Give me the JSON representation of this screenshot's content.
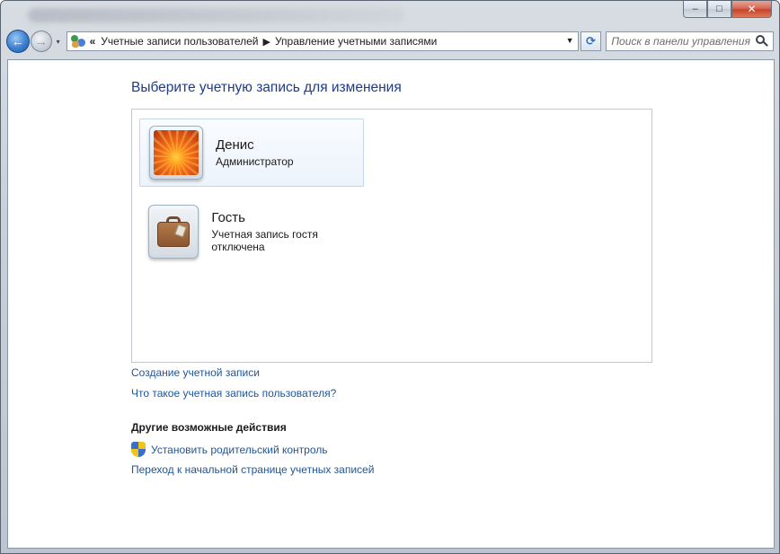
{
  "window": {
    "caption_buttons": {
      "minimize": "–",
      "maximize": "□",
      "close": "✕"
    }
  },
  "nav": {
    "back_icon": "arrow-left-icon",
    "forward_icon": "arrow-right-icon",
    "back_glyph": "←",
    "forward_glyph": "→",
    "history_glyph": "▾",
    "breadcrumb": {
      "lead": "«",
      "items": [
        "Учетные записи пользователей",
        "Управление учетными записями"
      ],
      "separator": "▶"
    },
    "address_dropdown_glyph": "▼",
    "refresh_glyph": "⟳",
    "search": {
      "placeholder": "Поиск в панели управления"
    }
  },
  "main": {
    "title": "Выберите учетную запись для изменения",
    "accounts": [
      {
        "name": "Денис",
        "role": "Администратор",
        "avatar": "flower-avatar",
        "selected": true
      },
      {
        "name": "Гость",
        "role": "Учетная запись гостя отключена",
        "avatar": "briefcase-avatar",
        "selected": false
      }
    ],
    "links": {
      "create_account": "Создание учетной записи",
      "what_is_account": "Что такое учетная запись пользователя?"
    },
    "other_actions": {
      "heading": "Другие возможные действия",
      "parental_control": "Установить родительский контроль",
      "home_page": "Переход к начальной странице учетных записей"
    }
  },
  "colors": {
    "link": "#1f5599",
    "title": "#1e3b87",
    "selection_border": "#c4d6ea"
  }
}
